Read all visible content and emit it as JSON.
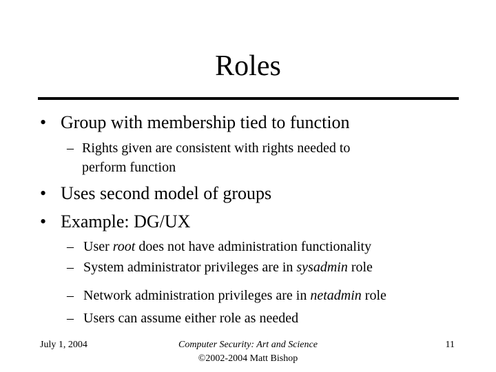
{
  "slide": {
    "title": "Roles",
    "bullets": [
      {
        "text": "Group with membership tied to function",
        "sub": [
          "Rights given are consistent with rights needed to",
          "perform function"
        ]
      },
      {
        "text": "Uses second model of groups"
      },
      {
        "text": "Example: DG/UX"
      }
    ],
    "example_sub": [
      {
        "pre": "User ",
        "em": "root",
        "post": " does not have administration functionality"
      },
      {
        "pre": "System administrator privileges are in ",
        "em": "sysadmin",
        "post": " role"
      },
      {
        "pre": "Network administration privileges are in ",
        "em": "netadmin",
        "post": " role"
      },
      {
        "pre": "Users can assume either role as needed",
        "em": "",
        "post": ""
      }
    ],
    "bullet_glyph": "•",
    "dash_glyph": "–"
  },
  "footer": {
    "date": "July 1, 2004",
    "course": "Computer Security: Art and Science",
    "copyright": "©2002-2004 Matt Bishop",
    "page": "11"
  }
}
